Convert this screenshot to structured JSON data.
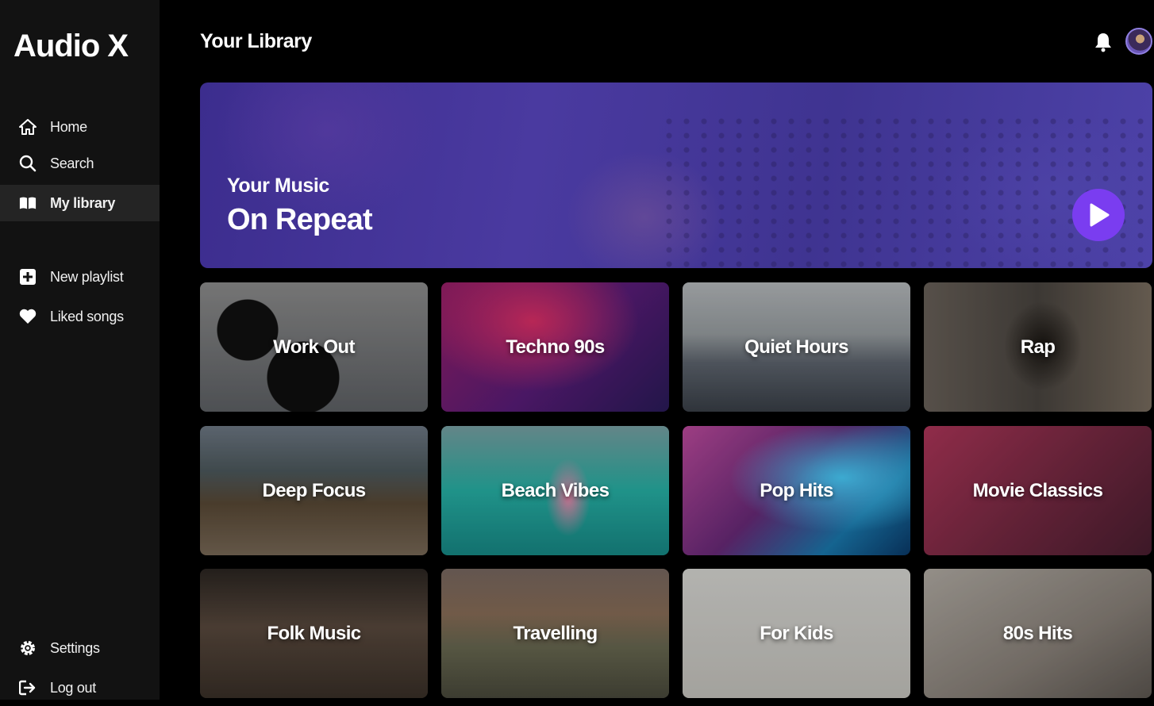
{
  "app": {
    "title": "Audio X"
  },
  "sidebar": {
    "items": [
      {
        "label": "Home",
        "icon": "home-icon"
      },
      {
        "label": "Search",
        "icon": "search-icon"
      },
      {
        "label": "My library",
        "icon": "library-icon",
        "active": true
      },
      {
        "label": "New playlist",
        "icon": "plus-square-icon"
      },
      {
        "label": "Liked songs",
        "icon": "heart-icon"
      },
      {
        "label": "Settings",
        "icon": "gear-icon"
      },
      {
        "label": "Log out",
        "icon": "logout-icon"
      }
    ]
  },
  "header": {
    "title": "Your Library"
  },
  "hero": {
    "subtitle": "Your Music",
    "title": "On Repeat",
    "accent": "#7a3df0"
  },
  "playlists": [
    {
      "label": "Work Out"
    },
    {
      "label": "Techno 90s"
    },
    {
      "label": "Quiet Hours"
    },
    {
      "label": "Rap"
    },
    {
      "label": "Deep Focus"
    },
    {
      "label": "Beach Vibes"
    },
    {
      "label": "Pop Hits"
    },
    {
      "label": "Movie Classics"
    },
    {
      "label": "Folk Music"
    },
    {
      "label": "Travelling"
    },
    {
      "label": "For Kids"
    },
    {
      "label": "80s Hits"
    }
  ]
}
